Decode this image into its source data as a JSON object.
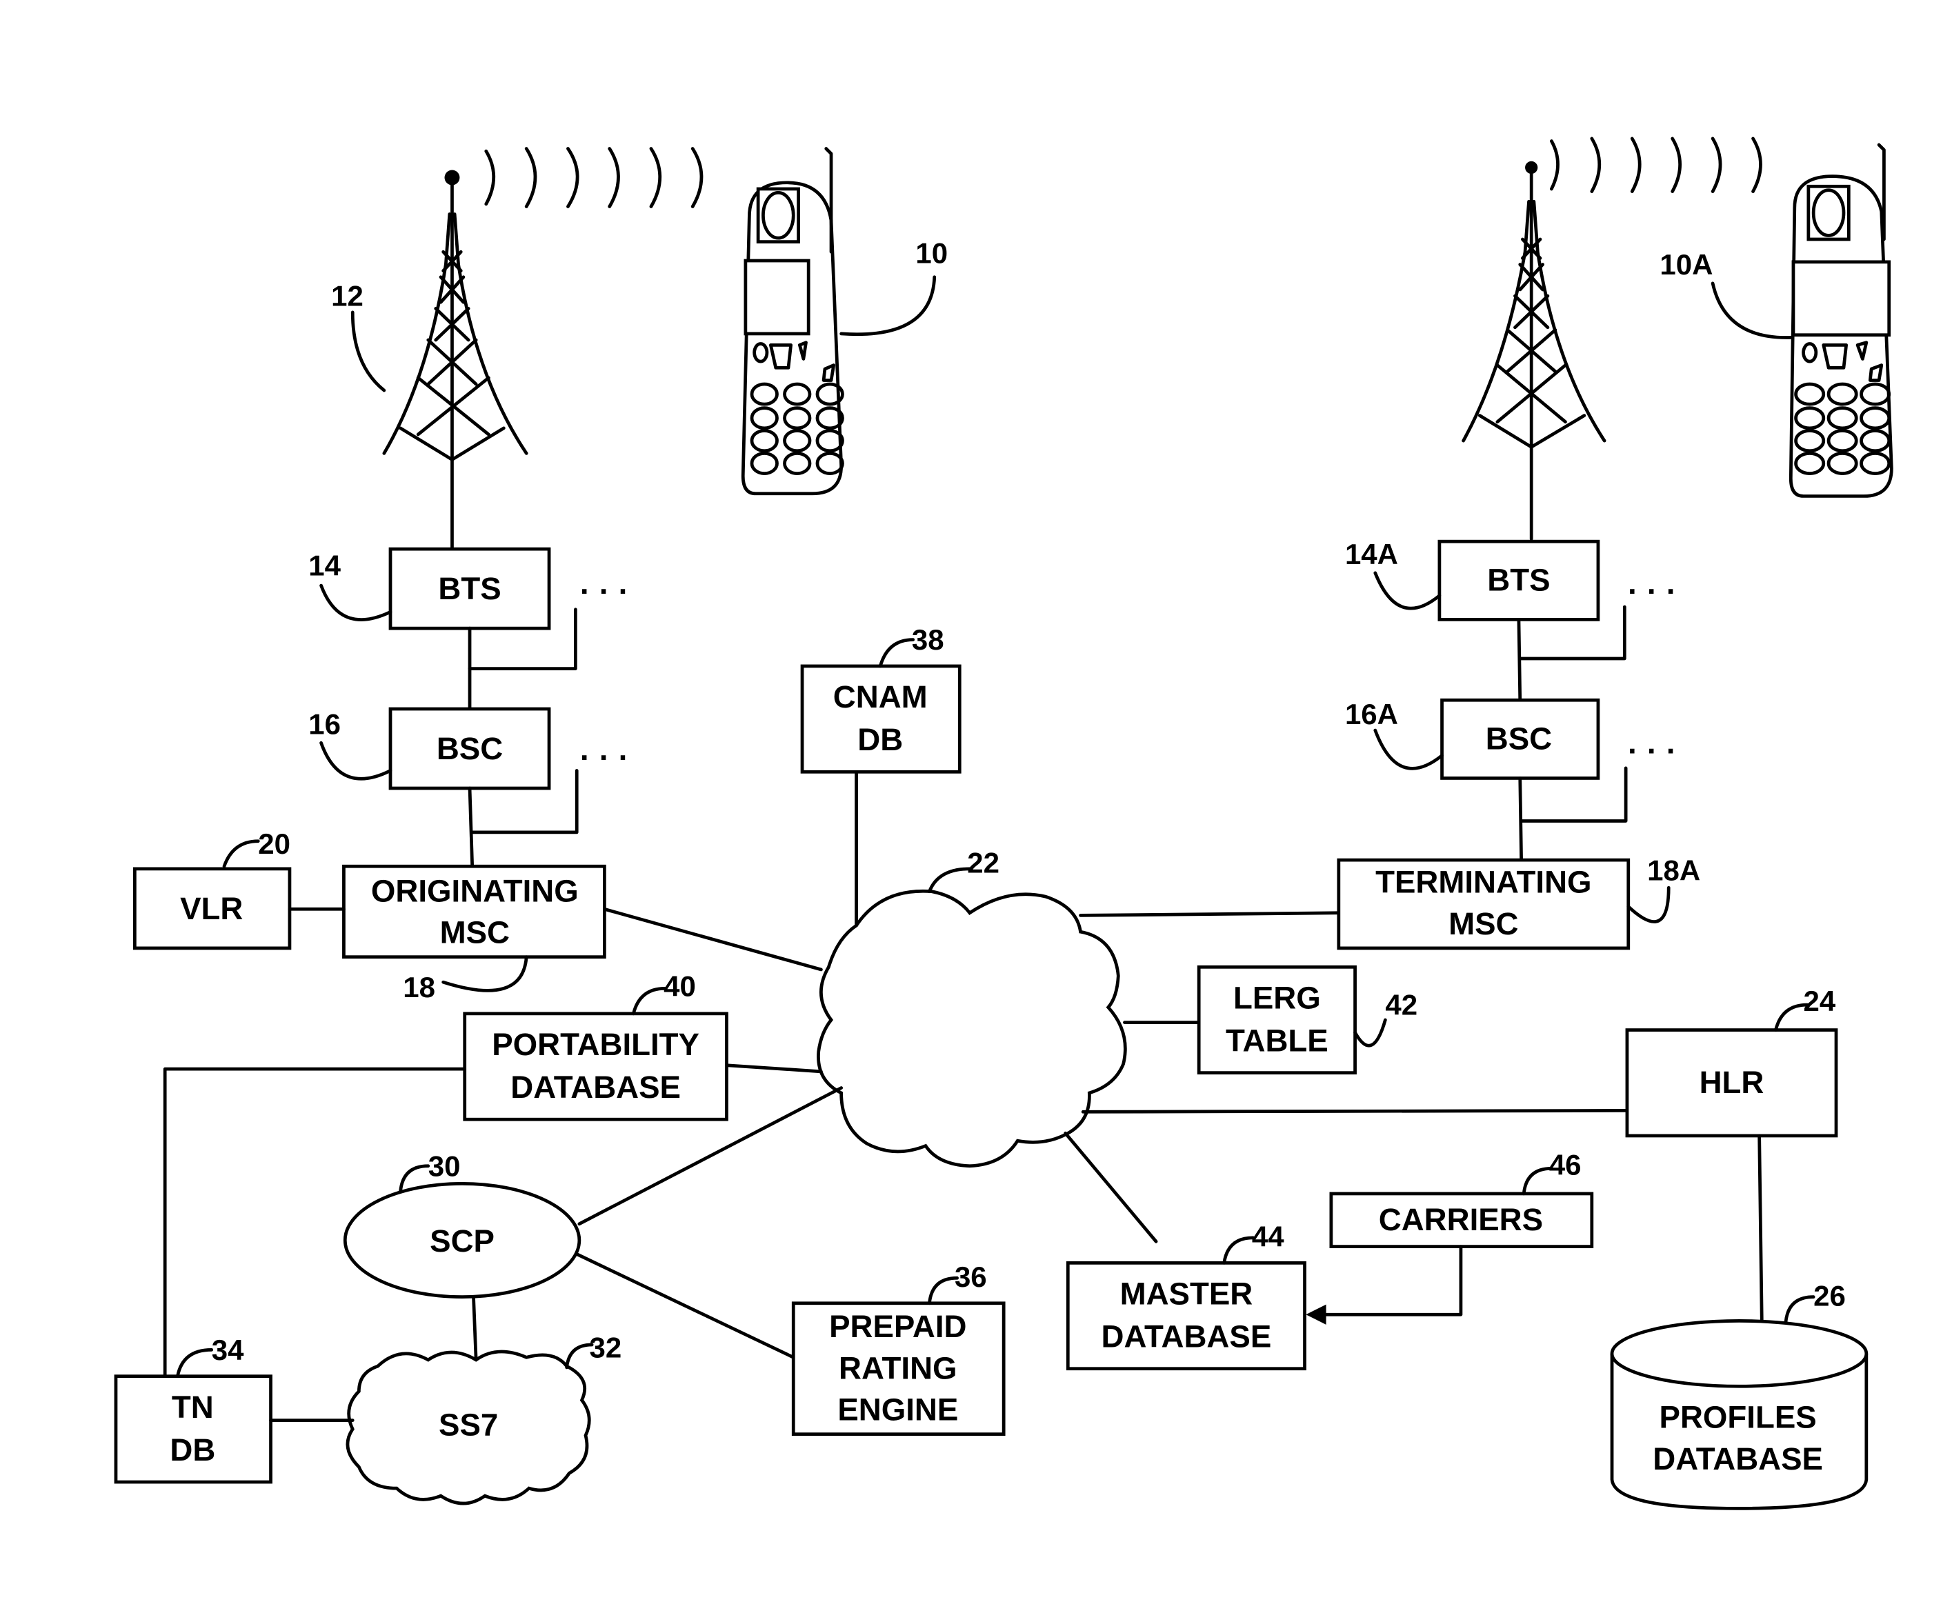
{
  "diagram": {
    "colors": {
      "stroke": "#000000",
      "background": "#ffffff"
    },
    "left_site": {
      "tower": {
        "ref": "12",
        "icon": "cell-tower-icon"
      },
      "phone": {
        "ref": "10",
        "icon": "mobile-phone-icon"
      },
      "bts": {
        "label": "BTS",
        "ref": "14"
      },
      "bsc": {
        "label": "BSC",
        "ref": "16"
      },
      "msc": {
        "line1": "ORIGINATING",
        "line2": "MSC",
        "ref": "18"
      },
      "vlr": {
        "label": "VLR",
        "ref": "20"
      },
      "ellipsis": "· · ·"
    },
    "right_site": {
      "phone": {
        "ref": "10A",
        "icon": "mobile-phone-icon"
      },
      "bts": {
        "label": "BTS",
        "ref": "14A"
      },
      "bsc": {
        "label": "BSC",
        "ref": "16A"
      },
      "msc": {
        "line1": "TERMINATING",
        "line2": "MSC",
        "ref": "18A"
      },
      "ellipsis": "· · ·"
    },
    "network": {
      "ref": "22"
    },
    "cnam": {
      "line1": "CNAM",
      "line2": "DB",
      "ref": "38"
    },
    "portability": {
      "line1": "PORTABILITY",
      "line2": "DATABASE",
      "ref": "40"
    },
    "lerg": {
      "line1": "LERG",
      "line2": "TABLE",
      "ref": "42"
    },
    "hlr": {
      "label": "HLR",
      "ref": "24"
    },
    "profiles": {
      "line1": "PROFILES",
      "line2": "DATABASE",
      "ref": "26"
    },
    "carriers": {
      "label": "CARRIERS",
      "ref": "46"
    },
    "master": {
      "line1": "MASTER",
      "line2": "DATABASE",
      "ref": "44"
    },
    "scp": {
      "label": "SCP",
      "ref": "30"
    },
    "ss7": {
      "label": "SS7",
      "ref": "32"
    },
    "tndb": {
      "line1": "TN",
      "line2": "DB",
      "ref": "34"
    },
    "prepaid": {
      "line1": "PREPAID",
      "line2": "RATING",
      "line3": "ENGINE",
      "ref": "36"
    }
  }
}
